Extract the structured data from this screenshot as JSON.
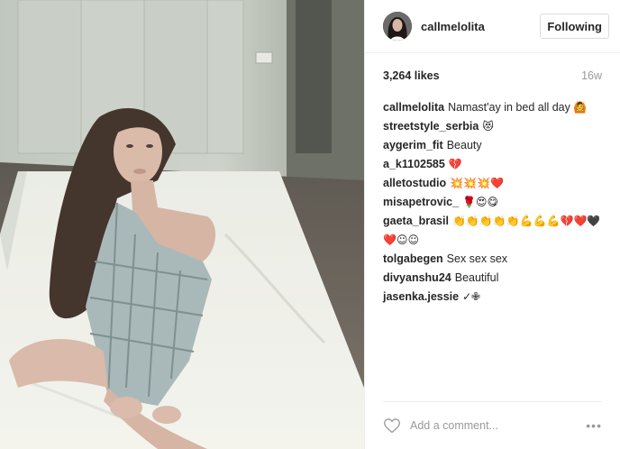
{
  "post": {
    "username": "callmelolita",
    "follow_label": "Following",
    "likes": "3,264 likes",
    "age": "16w"
  },
  "comments": [
    {
      "user": "callmelolita",
      "text": "Namast'ay in bed all day",
      "emoji": "🙆"
    },
    {
      "user": "streetstyle_serbia",
      "text": "",
      "emoji": "😻"
    },
    {
      "user": "aygerim_fit",
      "text": "Beauty",
      "emoji": ""
    },
    {
      "user": "a_k1102585",
      "text": "",
      "emoji": "💔"
    },
    {
      "user": "alletostudio",
      "text": "",
      "emoji": "💥💥💥❤️"
    },
    {
      "user": "misapetrovic_",
      "text": "",
      "emoji": "🌹😍😋"
    },
    {
      "user": "gaeta_brasil",
      "text": "",
      "emoji": "👏👏👏👏👏💪💪💪💔❤️🖤❤️☺☺"
    },
    {
      "user": "tolgabegen",
      "text": "Sex sex sex",
      "emoji": ""
    },
    {
      "user": "divyanshu24",
      "text": "Beautiful",
      "emoji": ""
    },
    {
      "user": "jasenka.jessie",
      "text": "✓✙",
      "emoji": ""
    }
  ],
  "footer": {
    "comment_placeholder": "Add a comment...",
    "more_label": "•••",
    "like_icon": "heart-outline-icon"
  },
  "colors": {
    "text": "#262626",
    "muted": "#999999",
    "border": "#efefef"
  }
}
